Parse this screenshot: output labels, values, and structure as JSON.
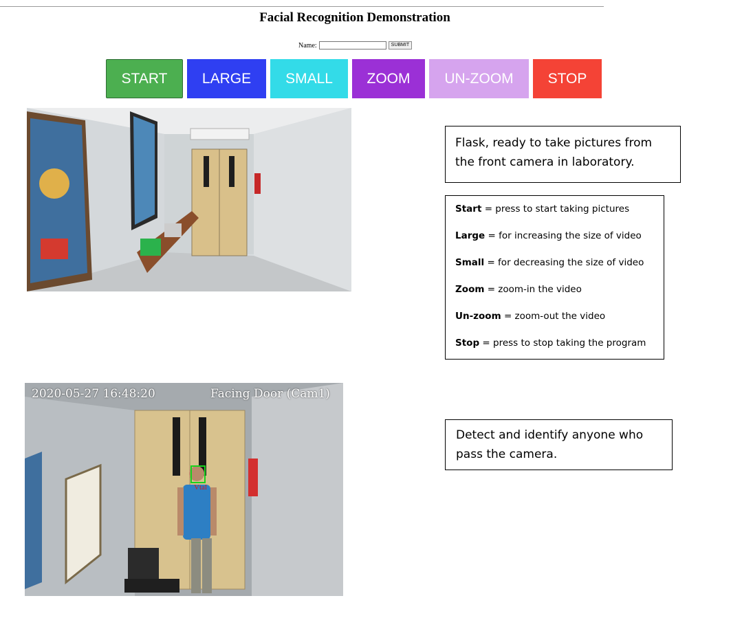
{
  "page": {
    "title": "Facial Recognition Demonstration"
  },
  "form": {
    "name_label": "Name:",
    "name_value": "",
    "submit_label": "SUBMIT"
  },
  "controls": [
    {
      "key": "start",
      "label": "START",
      "color": "#4caf50"
    },
    {
      "key": "large",
      "label": "LARGE",
      "color": "#2f3ff2"
    },
    {
      "key": "small",
      "label": "SMALL",
      "color": "#33dbe8"
    },
    {
      "key": "zoom",
      "label": "ZOOM",
      "color": "#9b30d6"
    },
    {
      "key": "unzoom",
      "label": "UN-ZOOM",
      "color": "#d6a4ee"
    },
    {
      "key": "stop",
      "label": "STOP",
      "color": "#f44336"
    }
  ],
  "camera2": {
    "timestamp": "2020-05-27 16:48:20",
    "label": "Facing Door (Cam1)",
    "face_tag": "Vtal"
  },
  "info": {
    "intro": "Flask, ready to take pictures from the front camera in laboratory.",
    "detect": "Detect and identify anyone who pass the camera.",
    "legend": [
      {
        "term": "Start",
        "desc": " = press to start taking pictures"
      },
      {
        "term": "Large",
        "desc": " = for increasing the size of video"
      },
      {
        "term": "Small",
        "desc": " = for decreasing the size of video"
      },
      {
        "term": "Zoom",
        "desc": " = zoom-in the video"
      },
      {
        "term": "Un-zoom",
        "desc": " = zoom-out the video"
      },
      {
        "term": "Stop",
        "desc": " = press to stop taking the program"
      }
    ]
  }
}
